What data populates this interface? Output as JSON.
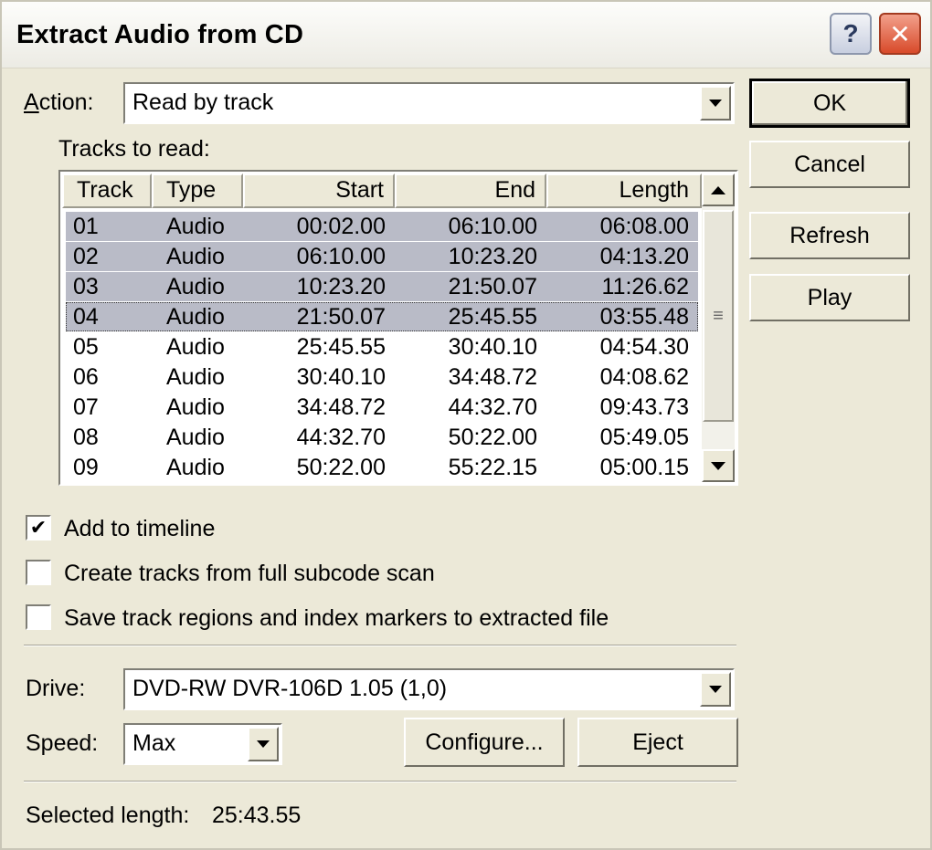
{
  "window": {
    "title": "Extract Audio from CD",
    "help_glyph": "?",
    "close_glyph": "✕"
  },
  "action": {
    "label_prefix": "",
    "label_underlined": "A",
    "label_rest": "ction:",
    "value": "Read by track"
  },
  "tracks_label": "Tracks to read:",
  "table": {
    "columns": [
      "Track",
      "Type",
      "Start",
      "End",
      "Length"
    ],
    "rows": [
      {
        "track": "01",
        "type": "Audio",
        "start": "00:02.00",
        "end": "06:10.00",
        "length": "06:08.00",
        "selected": true
      },
      {
        "track": "02",
        "type": "Audio",
        "start": "06:10.00",
        "end": "10:23.20",
        "length": "04:13.20",
        "selected": true
      },
      {
        "track": "03",
        "type": "Audio",
        "start": "10:23.20",
        "end": "21:50.07",
        "length": "11:26.62",
        "selected": true
      },
      {
        "track": "04",
        "type": "Audio",
        "start": "21:50.07",
        "end": "25:45.55",
        "length": "03:55.48",
        "selected": true
      },
      {
        "track": "05",
        "type": "Audio",
        "start": "25:45.55",
        "end": "30:40.10",
        "length": "04:54.30",
        "selected": false
      },
      {
        "track": "06",
        "type": "Audio",
        "start": "30:40.10",
        "end": "34:48.72",
        "length": "04:08.62",
        "selected": false
      },
      {
        "track": "07",
        "type": "Audio",
        "start": "34:48.72",
        "end": "44:32.70",
        "length": "09:43.73",
        "selected": false
      },
      {
        "track": "08",
        "type": "Audio",
        "start": "44:32.70",
        "end": "50:22.00",
        "length": "05:49.05",
        "selected": false
      },
      {
        "track": "09",
        "type": "Audio",
        "start": "50:22.00",
        "end": "55:22.15",
        "length": "05:00.15",
        "selected": false
      }
    ]
  },
  "buttons": {
    "ok": "OK",
    "cancel": "Cancel",
    "refresh": "Refresh",
    "play": "Play",
    "configure": "Configure...",
    "eject": "Eject"
  },
  "options": {
    "add_to_timeline": {
      "label": "Add to timeline",
      "checked": true
    },
    "create_tracks": {
      "label": "Create tracks from full subcode scan",
      "checked": false
    },
    "save_regions": {
      "label": "Save track regions and index markers to extracted file",
      "checked": false
    }
  },
  "drive": {
    "label": "Drive:",
    "value": "DVD-RW  DVR-106D 1.05 (1,0)"
  },
  "speed": {
    "label": "Speed:",
    "value": "Max"
  },
  "status": {
    "selected_length_label": "Selected length:",
    "selected_length_value": "25:43.55"
  }
}
